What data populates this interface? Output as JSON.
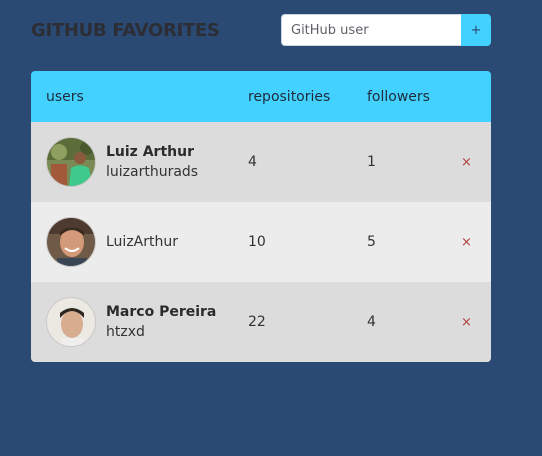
{
  "header": {
    "title": "Github Favorites",
    "search_placeholder": "GitHub user",
    "add_label": "+"
  },
  "table": {
    "columns": [
      "users",
      "repositories",
      "followers"
    ],
    "rows": [
      {
        "name": "Luiz Arthur",
        "login": "luizarthurads",
        "repositories": "4",
        "followers": "1",
        "remove_label": "×",
        "avatar_icon": "user-photo-green-shirt"
      },
      {
        "name": "",
        "login": "LuizArthur",
        "repositories": "10",
        "followers": "5",
        "remove_label": "×",
        "avatar_icon": "user-photo-smiling"
      },
      {
        "name": "Marco Pereira",
        "login": "htzxd",
        "repositories": "22",
        "followers": "4",
        "remove_label": "×",
        "avatar_icon": "user-photo-young-man"
      }
    ]
  },
  "colors": {
    "background": "#2a4a73",
    "accent": "#43d2ff",
    "row_odd": "#dcdcdc",
    "row_even": "#ececec",
    "remove": "#b0413e"
  }
}
